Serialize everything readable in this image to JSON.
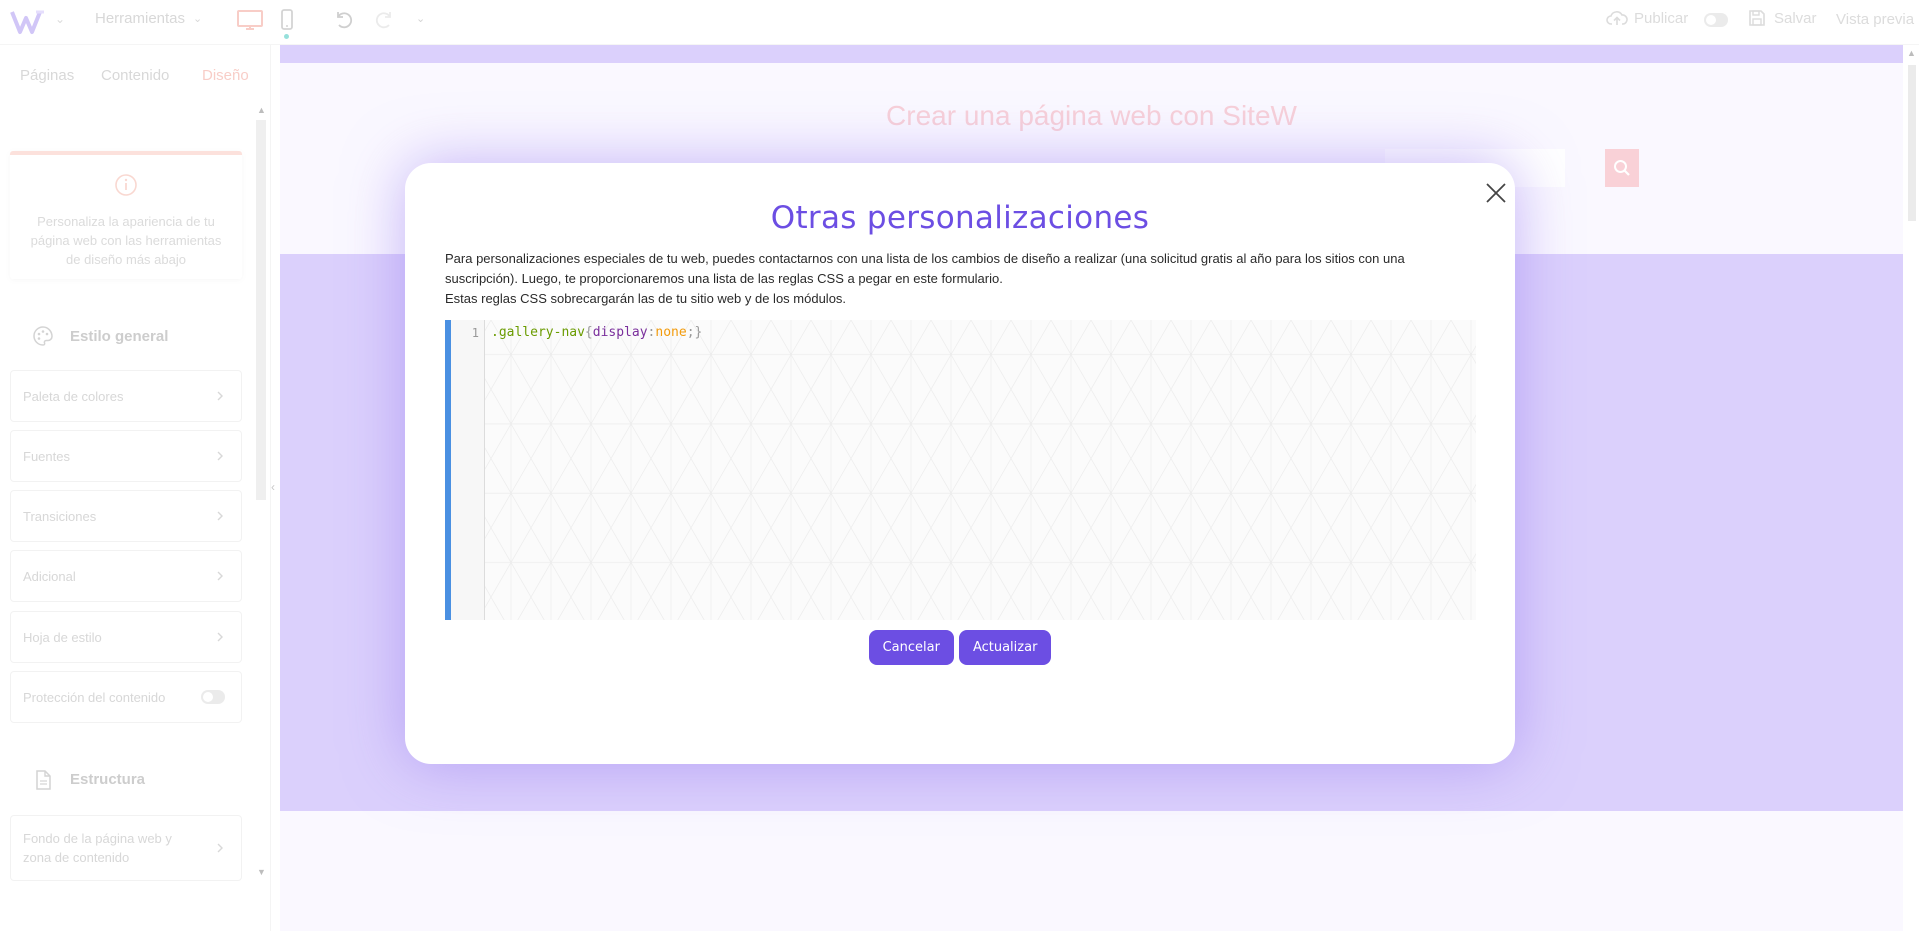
{
  "toolbar": {
    "logo_icon": "sitew-logo-icon",
    "tools_label": "Herramientas",
    "publish_label": "Publicar",
    "save_label": "Salvar",
    "preview_label": "Vista previa"
  },
  "sidebar": {
    "tabs": [
      {
        "label": "Páginas",
        "active": false
      },
      {
        "label": "Contenido",
        "active": false
      },
      {
        "label": "Diseño",
        "active": true
      }
    ],
    "info_text": "Personaliza la apariencia de tu página web con las herramientas de diseño más abajo",
    "section_general": "Estilo general",
    "items_general": [
      {
        "label": "Paleta de colores"
      },
      {
        "label": "Fuentes"
      },
      {
        "label": "Transiciones"
      },
      {
        "label": "Adicional"
      },
      {
        "label": "Hoja de estilo"
      },
      {
        "label": "Protección del contenido"
      }
    ],
    "section_structure": "Estructura",
    "items_structure": [
      {
        "label": "Fondo de la página web y zona de contenido"
      }
    ]
  },
  "site": {
    "title": "Crear una página web con SiteW"
  },
  "modal": {
    "title": "Otras personalizaciones",
    "desc_line1": "Para personalizaciones especiales de tu web, puedes contactarnos con una lista de los cambios de diseño a realizar (una solicitud gratis al año para los sitios con una suscripción). Luego, te proporcionaremos una lista de las reglas CSS a pegar en este formulario.",
    "desc_line2": "Estas reglas CSS sobrecargarán las de tu sitio web y de los módulos.",
    "code": {
      "line_number": "1",
      "selector": ".gallery-nav",
      "open_brace": "{",
      "property": "display",
      "colon": ":",
      "value": "none",
      "semicolon": ";",
      "close_brace": "}"
    },
    "cancel_label": "Cancelar",
    "update_label": "Actualizar"
  },
  "colors": {
    "accent": "#6c4ee3",
    "band": "#c8b7fb",
    "title_pink": "#f3b7c4",
    "active_tab": "#f4b3aa"
  }
}
